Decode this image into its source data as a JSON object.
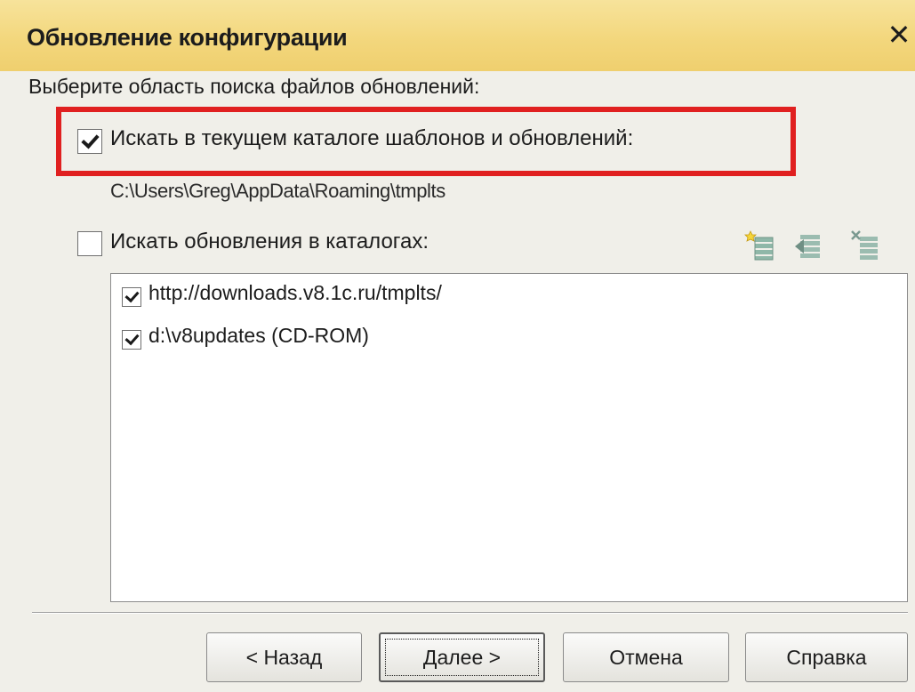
{
  "window": {
    "title": "Обновление конфигурации",
    "close_glyph": "✕"
  },
  "prompt": "Выберите область поиска файлов обновлений:",
  "option_current": {
    "label": "Искать в текущем каталоге шаблонов и обновлений:",
    "checked": true,
    "path": "C:\\Users\\Greg\\AppData\\Roaming\\tmplts",
    "highlight_color": "#e02020"
  },
  "option_catalogs": {
    "label": "Искать обновления в каталогах:",
    "checked": false,
    "toolbar": [
      "add-item-icon",
      "move-item-icon",
      "delete-item-icon"
    ],
    "items": [
      {
        "text": "http://downloads.v8.1c.ru/tmplts/",
        "checked": true
      },
      {
        "text": "d:\\v8updates (CD-ROM)",
        "checked": true
      }
    ]
  },
  "buttons": {
    "back": "< Назад",
    "next": "Далее >",
    "cancel": "Отмена",
    "help": "Справка"
  },
  "colors": {
    "titlebar": "#f3d77d",
    "background": "#f0efe9"
  }
}
